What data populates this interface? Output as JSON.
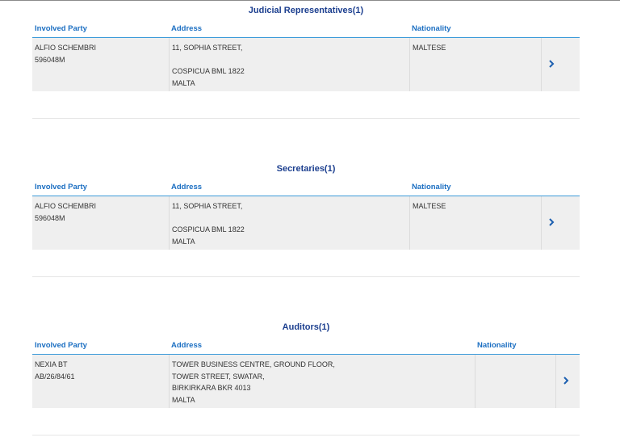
{
  "sections": [
    {
      "title": "Judicial Representatives(1)",
      "headers": {
        "party": "Involved Party",
        "address": "Address",
        "nationality": "Nationality"
      },
      "row": {
        "party": [
          "ALFIO SCHEMBRI",
          "596048M"
        ],
        "address": [
          "11, SOPHIA STREET,",
          "",
          "COSPICUA BML 1822",
          "MALTA"
        ],
        "nationality": "MALTESE"
      }
    },
    {
      "title": "Secretaries(1)",
      "headers": {
        "party": "Involved Party",
        "address": "Address",
        "nationality": "Nationality"
      },
      "row": {
        "party": [
          "ALFIO SCHEMBRI",
          "596048M"
        ],
        "address": [
          "11, SOPHIA STREET,",
          "",
          "COSPICUA BML 1822",
          "MALTA"
        ],
        "nationality": "MALTESE"
      }
    },
    {
      "title": "Auditors(1)",
      "headers": {
        "party": "Involved Party",
        "address": "Address",
        "nationality": "Nationality"
      },
      "row": {
        "party": [
          "NEXIA BT",
          "AB/26/84/61"
        ],
        "address": [
          "TOWER BUSINESS CENTRE, GROUND FLOOR,",
          "TOWER STREET, SWATAR,",
          "BIRKIRKARA BKR 4013",
          "MALTA"
        ],
        "nationality": ""
      }
    }
  ],
  "colors": {
    "title": "#1c3f8f",
    "header": "#1c6fc2",
    "rule": "#3a9ad9",
    "row_bg": "#efefef",
    "chevron": "#1c5fb0"
  },
  "icons": {
    "row_action": "chevron-right-icon"
  }
}
